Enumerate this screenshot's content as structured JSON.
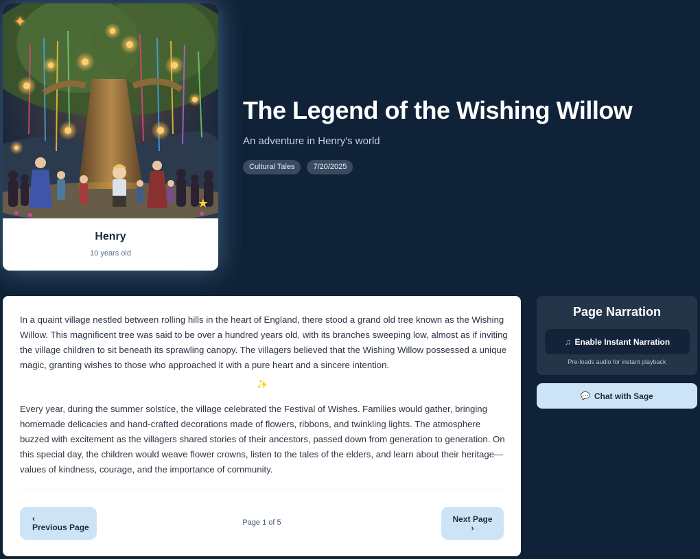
{
  "character": {
    "name": "Henry",
    "age": "10 years old",
    "image_alt": "Illustration of children gathered under a lantern-lit willow tree",
    "sparkle_icon": "sparkle-icon",
    "star_icon": "star-icon"
  },
  "story": {
    "title": "The Legend of the Wishing Willow",
    "subtitle": "An adventure in Henry's world",
    "tags": [
      "Cultural Tales",
      "7/20/2025"
    ],
    "paragraphs": [
      "In a quaint village nestled between rolling hills in the heart of England, there stood a grand old tree known as the Wishing Willow. This magnificent tree was said to be over a hundred years old, with its branches sweeping low, almost as if inviting the village children to sit beneath its sprawling canopy. The villagers believed that the Wishing Willow possessed a unique magic, granting wishes to those who approached it with a pure heart and a sincere intention.",
      "Every year, during the summer solstice, the village celebrated the Festival of Wishes. Families would gather, bringing homemade delicacies and hand-crafted decorations made of flowers, ribbons, and twinkling lights. The atmosphere buzzed with excitement as the villagers shared stories of their ancestors, passed down from generation to generation. On this special day, the children would weave flower crowns, listen to the tales of the elders, and learn about their heritage—values of kindness, courage, and the importance of community."
    ],
    "divider_icon": "sparkles-icon"
  },
  "pagination": {
    "prev_label": "Previous Page",
    "prev_chevron": "‹",
    "next_label": "Next Page",
    "next_chevron": "›",
    "indicator": "Page 1 of 5"
  },
  "narration": {
    "title": "Page Narration",
    "button_label": "Enable Instant Narration",
    "button_icon": "♫",
    "note": "Pre-loads audio for instant playback"
  },
  "chat": {
    "label": "Chat with Sage",
    "icon": "💬"
  }
}
